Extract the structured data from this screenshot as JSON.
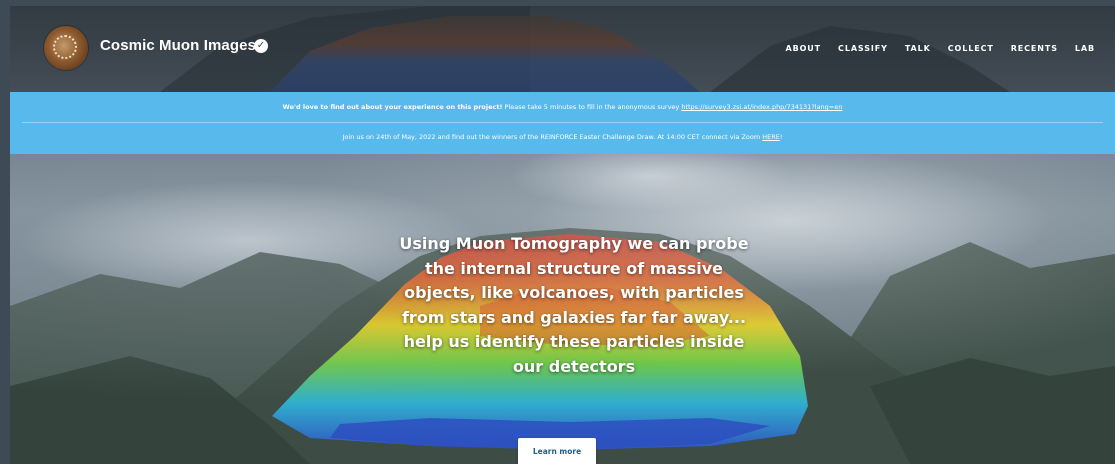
{
  "header": {
    "project_title": "Cosmic Muon Images",
    "nav": [
      {
        "label": "ABOUT"
      },
      {
        "label": "CLASSIFY"
      },
      {
        "label": "TALK"
      },
      {
        "label": "COLLECT"
      },
      {
        "label": "RECENTS"
      },
      {
        "label": "LAB"
      }
    ]
  },
  "banner": {
    "line1_bold": "We'd love to find out about your experience on this project!",
    "line1_text": " Please take 5 minutes to fill in the anonymous survey ",
    "line1_link": "https://survey3.zsi.at/index.php/734131?lang=en",
    "line2_text": "Join us on 24th of May, 2022 and find out the winners of the REINFORCE Easter Challenge Draw. At 14:00 CET connect via Zoom ",
    "line2_link": "HERE",
    "line2_end": "!"
  },
  "hero": {
    "text": "Using Muon Tomography we can probe the internal structure of massive objects, like volcanoes, with particles from stars and galaxies far far away... help us identify these particles inside our detectors",
    "button_label": "Learn more"
  },
  "colors": {
    "banner": "#58b9ec",
    "heatmap_high": "#c8261a",
    "heatmap_mid": "#e8d21c",
    "heatmap_low": "#2f56c8"
  }
}
